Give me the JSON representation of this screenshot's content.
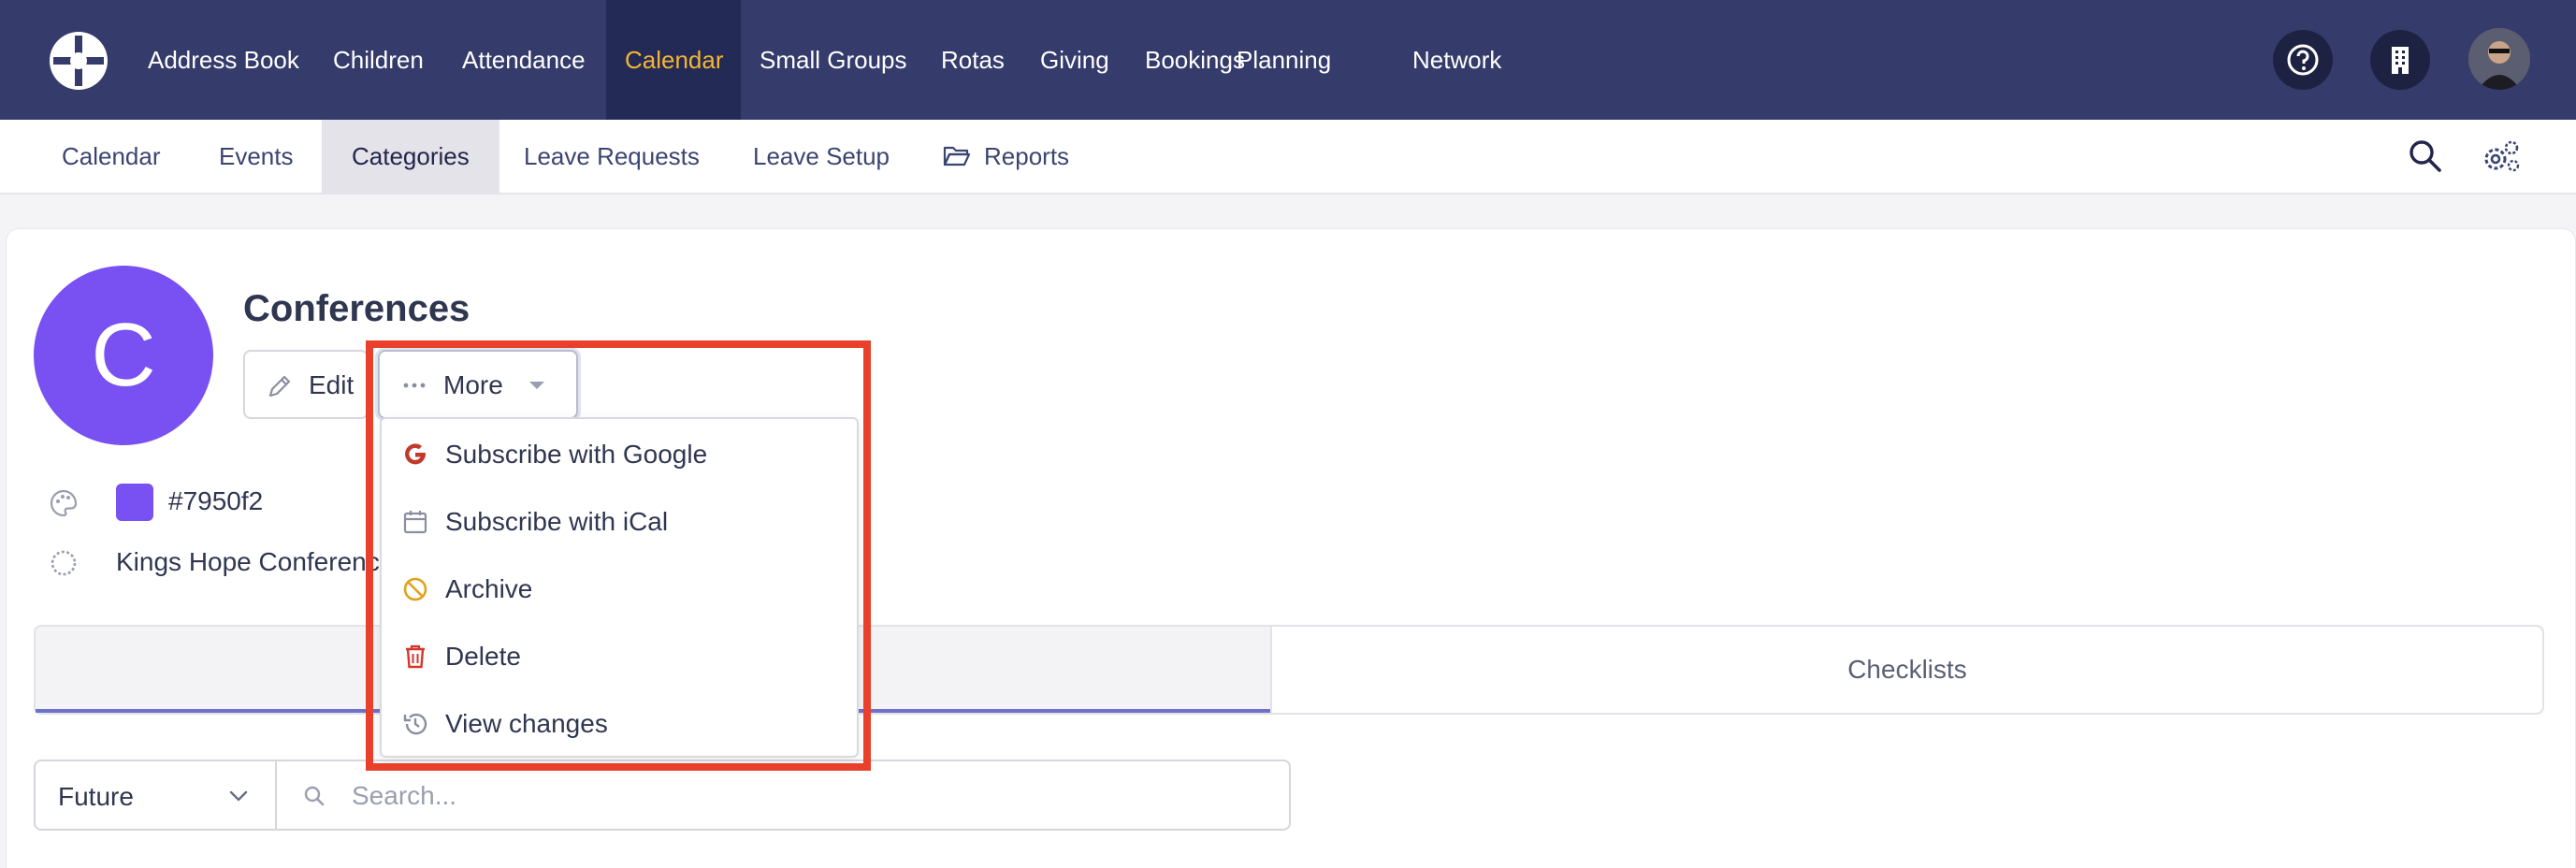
{
  "topnav": {
    "items": [
      {
        "label": "Address Book"
      },
      {
        "label": "Children"
      },
      {
        "label": "Attendance"
      },
      {
        "label": "Calendar",
        "active": true
      },
      {
        "label": "Small Groups"
      },
      {
        "label": "Rotas"
      },
      {
        "label": "Giving"
      },
      {
        "label": "Bookings"
      },
      {
        "label": "Planning"
      },
      {
        "label": "Network"
      }
    ],
    "icons": [
      "logo-icon",
      "help-icon",
      "building-icon",
      "avatar"
    ],
    "colors": {
      "background": "#353b6b",
      "active_bg": "#242a56",
      "active_text": "#f2b536"
    }
  },
  "subnav": {
    "items": [
      {
        "label": "Calendar"
      },
      {
        "label": "Events"
      },
      {
        "label": "Categories",
        "active": true
      },
      {
        "label": "Leave Requests"
      },
      {
        "label": "Leave Setup"
      },
      {
        "label": "Reports",
        "icon": "folder-open-icon"
      }
    ],
    "icons": [
      "search-icon",
      "settings-gear-icon"
    ]
  },
  "category": {
    "initial": "C",
    "title": "Conferences",
    "color_hex": "#7950f2",
    "description": "Kings Hope Conferenc",
    "color_icon": "palette-icon",
    "status_icon": "dashed-circle-icon"
  },
  "actions": {
    "edit_label": "Edit",
    "more_label": "More"
  },
  "more_menu": {
    "items": [
      {
        "label": "Subscribe with Google",
        "icon": "google-icon",
        "color": "#c0392b"
      },
      {
        "label": "Subscribe with iCal",
        "icon": "calendar-icon",
        "color": "#8a8ea0"
      },
      {
        "label": "Archive",
        "icon": "ban-icon",
        "color": "#e0a21a"
      },
      {
        "label": "Delete",
        "icon": "trash-icon",
        "color": "#d9342b"
      },
      {
        "label": "View changes",
        "icon": "history-icon",
        "color": "#8a8ea0"
      }
    ]
  },
  "tabs": {
    "right_label": "Checklists"
  },
  "filter": {
    "select_value": "Future",
    "search_placeholder": "Search..."
  }
}
